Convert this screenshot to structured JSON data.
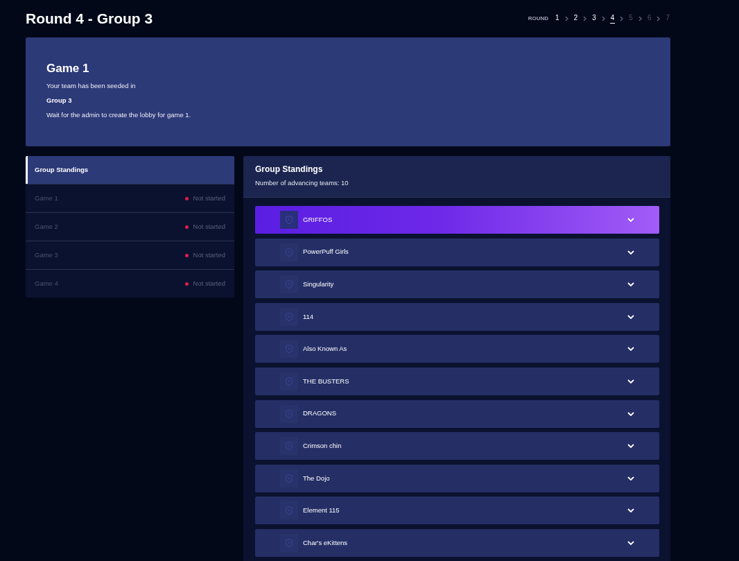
{
  "page": {
    "title": "Round 4 - Group 3"
  },
  "round_nav": {
    "label": "ROUND",
    "rounds": [
      {
        "label": "1",
        "selected": false,
        "disabled": false
      },
      {
        "label": "2",
        "selected": false,
        "disabled": false
      },
      {
        "label": "3",
        "selected": false,
        "disabled": false
      },
      {
        "label": "4",
        "selected": true,
        "disabled": false
      },
      {
        "label": "5",
        "selected": false,
        "disabled": true
      },
      {
        "label": "6",
        "selected": false,
        "disabled": true
      },
      {
        "label": "7",
        "selected": false,
        "disabled": true
      }
    ]
  },
  "banner": {
    "title": "Game 1",
    "lines": [
      {
        "kind": "plain",
        "text": "Your team has been seeded in"
      },
      {
        "kind": "bold",
        "text": "Group 3"
      },
      {
        "kind": "plain",
        "text": "Wait for the admin to create the lobby for game 1."
      }
    ]
  },
  "sidebar": {
    "items": [
      {
        "label": "Group Standings",
        "selected": true
      },
      {
        "label": "Game 1",
        "selected": false,
        "status": "Not started",
        "color": "#e11d48"
      },
      {
        "label": "Game 2",
        "selected": false,
        "status": "Not started",
        "color": "#e11d48"
      },
      {
        "label": "Game 3",
        "selected": false,
        "status": "Not started",
        "color": "#e11d48"
      },
      {
        "label": "Game 4",
        "selected": false,
        "status": "Not started",
        "color": "#e11d48"
      }
    ]
  },
  "standings": {
    "title": "Group Standings",
    "subtitle": "Number of advancing teams: 10",
    "teams": [
      {
        "name": "GRIFFOS",
        "selected": true
      },
      {
        "name": "PowerPuff Girls",
        "selected": false
      },
      {
        "name": "Singularity",
        "selected": false
      },
      {
        "name": "114",
        "selected": false
      },
      {
        "name": "Also Known As",
        "selected": false
      },
      {
        "name": "THE BUSTERS",
        "selected": false
      },
      {
        "name": "DRAGONS",
        "selected": false
      },
      {
        "name": "Crimson chin",
        "selected": false
      },
      {
        "name": "The Dojo",
        "selected": false
      },
      {
        "name": "Element 115",
        "selected": false
      },
      {
        "name": "Char's eKittens",
        "selected": false
      }
    ]
  }
}
